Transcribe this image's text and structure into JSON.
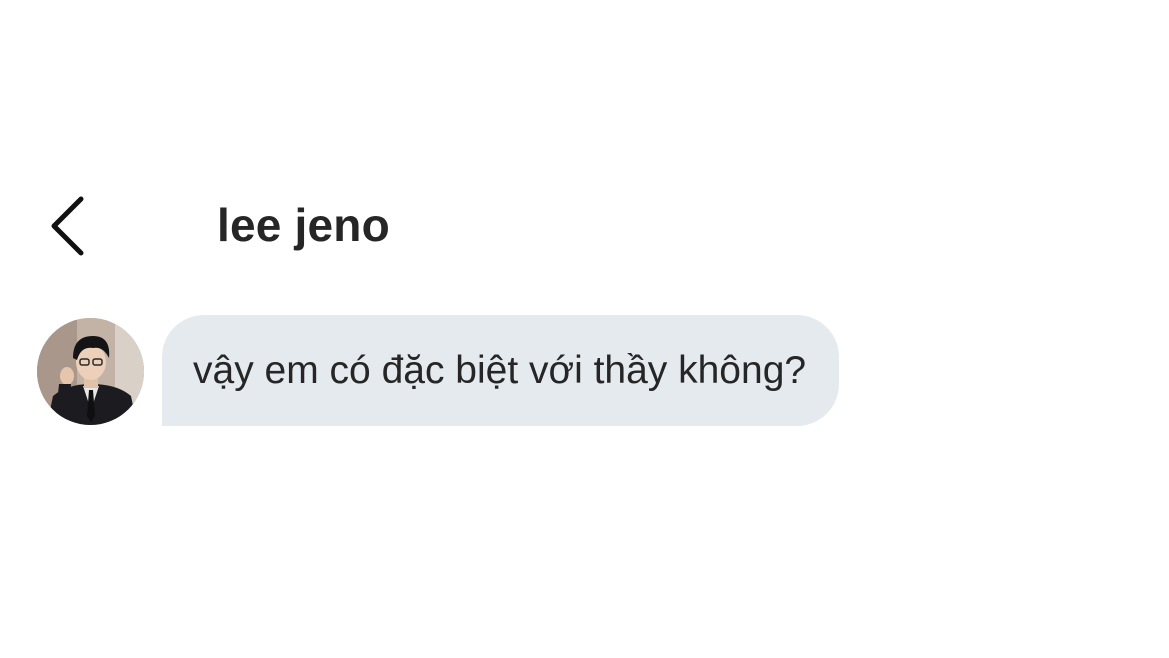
{
  "header": {
    "back_icon": "chevron-left-icon",
    "contact_name": "lee jeno"
  },
  "conversation": {
    "messages": [
      {
        "sender": "lee jeno",
        "avatar_icon": "avatar-photo",
        "text": "vậy em có đặc biệt với thầy không?"
      }
    ]
  },
  "colors": {
    "background": "#ffffff",
    "bubble": "#e5eaef",
    "text": "#262626"
  }
}
